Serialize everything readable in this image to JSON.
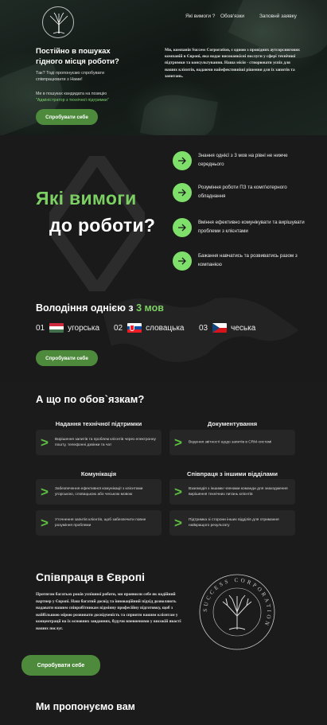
{
  "nav": {
    "items": [
      "Які вимоги ?",
      "Обов'язки",
      "Заповнй заявку"
    ]
  },
  "logo": {
    "ring_text": "SUCCESS CORPORATION",
    "icon": "tree-icon"
  },
  "hero": {
    "title": "Постійно в пошуках гідного місця роботи?",
    "subtitle": "Так? Тоді пропонуємо спробувати співпрацювати з Нами!",
    "note_prefix": "Ми в пошуках кандидата на позицію",
    "note_position": "\"Адміністратор з технічної підтримки\"",
    "cta": "Спробувати себе",
    "right_text": "Ми, компанія Success Corporation, є одною з провідних аутсорсингових компаній в Європі, яка надає високоякісні послуги у сфері технічної підтримки та консультування. Наша місія - створювати успіх для наших клієнтів, надаючи найефективніші рішення для їх запитів та запитань."
  },
  "requirements": {
    "title_line1": "Які вимоги",
    "title_line2": "до роботи?",
    "items": [
      "Знання однієї з 3 мов на рівні не нижче середнього",
      "Розуміння роботи ПЗ та комп'ютерного обладнання",
      "Вміння ефективно комунікувати та вирішувати проблеми з клієнтами",
      "Бажання навчатись та розвиватись разом з компанією"
    ],
    "lang_title_prefix": "Володіння однією з",
    "lang_title_highlight": "3 мов",
    "languages": [
      {
        "num": "01",
        "name": "угорська",
        "flag": "hungary-flag"
      },
      {
        "num": "02",
        "name": "словацька",
        "flag": "slovakia-flag"
      },
      {
        "num": "03",
        "name": "чеська",
        "flag": "czech-flag"
      }
    ],
    "cta": "Спробувати себе"
  },
  "duties": {
    "title": "А що по обов`язкам?",
    "columns": [
      {
        "heading": "Надання технічної підтримки",
        "cards": [
          "Вирішення запитів та проблем клієнтів через електронну пошту, телефонні дзвінки та чат"
        ]
      },
      {
        "heading": "Документування",
        "cards": [
          "Ведення звітності щодо запитів в CRM-системі"
        ]
      },
      {
        "heading": "Комунікація",
        "cards": [
          "Забезпечення ефективної комунікації з клієнтами угорською, словацькою або чеською мовою",
          "Уточнення запитів клієнтів, щоб забезпечити повне розуміння проблеми"
        ]
      },
      {
        "heading": "Співпраця з іншими відділами",
        "cards": [
          "Взаємодія з іншими членами команди для знаходження вирішення технічних питань клієнтів",
          "Підтримка зі сторони інших відділів для отримання найкращого результату"
        ]
      }
    ]
  },
  "europe": {
    "title": "Співпраця в Європі",
    "text": "Протягом багатьох років успішної роботи, ми проявили себе як надійний партнер у Європі. Наш багатий досвід та інноваційний підхід дозволяють надавати нашим співробітникам відмінну професійну підготовку, щоб з найбільшою мірою розвивати досвідченість та сприяти нашим клієнтам у концентрації на їх основних завданнях, будучи впевненими у високій якості наших послуг.",
    "cta": "Спробувати себе",
    "offer_title": "Ми пропонуємо вам"
  },
  "colors": {
    "accent_green": "#7ccf63",
    "button_green": "#4e8a3c",
    "arrow_green": "#7ee06a",
    "background": "#1a1a1a"
  }
}
